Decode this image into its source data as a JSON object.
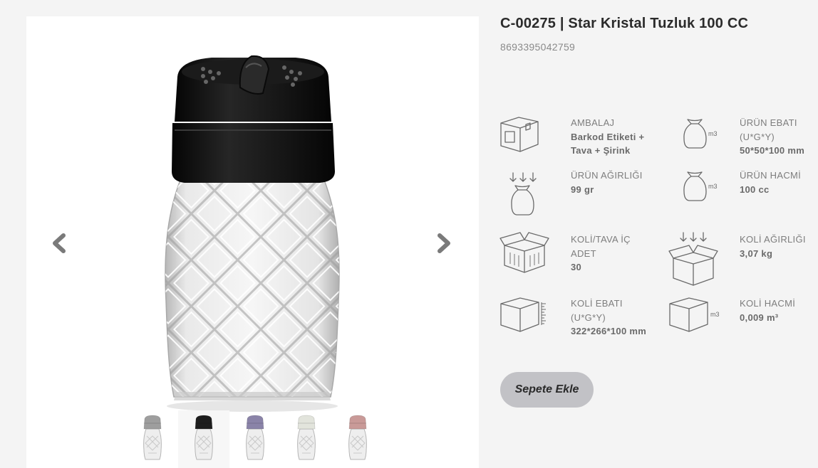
{
  "product": {
    "title": "C-00275 | Star Kristal Tuzluk 100 CC",
    "barcode": "8693395042759"
  },
  "gallery": {
    "prev_icon": "chevron-left-icon",
    "next_icon": "chevron-right-icon",
    "thumbnails": [
      {
        "cap_color": "#9e9e9e",
        "selected": false
      },
      {
        "cap_color": "#1e1e1e",
        "selected": true
      },
      {
        "cap_color": "#8a83a8",
        "selected": false
      },
      {
        "cap_color": "#e2e4dc",
        "selected": false
      },
      {
        "cap_color": "#c99a98",
        "selected": false
      }
    ]
  },
  "specs": {
    "packaging": {
      "label": "AMBALAJ",
      "value_line1": "Barkod Etiketi +",
      "value_line2": "Tava + Şirink",
      "icon": "box-icon"
    },
    "product_size": {
      "label_line1": "ÜRÜN EBATI",
      "label_line2": "(U*G*Y)",
      "value": "50*50*100 mm",
      "icon": "sack-m3-icon"
    },
    "product_weight": {
      "label": "ÜRÜN AĞIRLIĞI",
      "value": "99 gr",
      "icon": "sack-weight-icon"
    },
    "product_volume": {
      "label": "ÜRÜN HACMİ",
      "value": "100 cc",
      "icon": "sack-m3-icon"
    },
    "case_count": {
      "label_line1": "KOLİ/TAVA İÇ",
      "label_line2": "ADET",
      "value": "30",
      "icon": "open-box-icon"
    },
    "case_weight": {
      "label": "KOLİ AĞIRLIĞI",
      "value": "3,07 kg",
      "icon": "box-weight-icon"
    },
    "case_size": {
      "label_line1": "KOLİ EBATI",
      "label_line2": "(U*G*Y)",
      "value": "322*266*100 mm",
      "icon": "box-ruler-icon"
    },
    "case_volume": {
      "label": "KOLİ HACMİ",
      "value": "0,009 m³",
      "icon": "box-m3-icon"
    }
  },
  "m3_mark": "m3",
  "cart_button": {
    "label": "Sepete Ekle"
  }
}
